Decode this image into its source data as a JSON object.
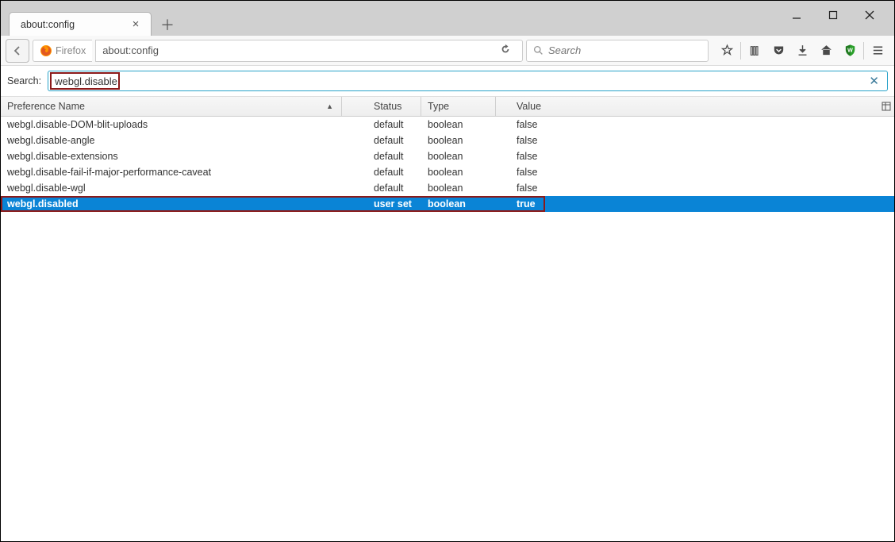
{
  "window": {
    "tab_title": "about:config"
  },
  "navbar": {
    "identity_label": "Firefox",
    "url": "about:config",
    "search_placeholder": "Search"
  },
  "config": {
    "search_label": "Search:",
    "search_value": "webgl.disable",
    "columns": {
      "name": "Preference Name",
      "status": "Status",
      "type": "Type",
      "value": "Value"
    },
    "rows": [
      {
        "name": "webgl.disable-DOM-blit-uploads",
        "status": "default",
        "type": "boolean",
        "value": "false",
        "selected": false
      },
      {
        "name": "webgl.disable-angle",
        "status": "default",
        "type": "boolean",
        "value": "false",
        "selected": false
      },
      {
        "name": "webgl.disable-extensions",
        "status": "default",
        "type": "boolean",
        "value": "false",
        "selected": false
      },
      {
        "name": "webgl.disable-fail-if-major-performance-caveat",
        "status": "default",
        "type": "boolean",
        "value": "false",
        "selected": false
      },
      {
        "name": "webgl.disable-wgl",
        "status": "default",
        "type": "boolean",
        "value": "false",
        "selected": false
      },
      {
        "name": "webgl.disabled",
        "status": "user set",
        "type": "boolean",
        "value": "true",
        "selected": true
      }
    ]
  }
}
